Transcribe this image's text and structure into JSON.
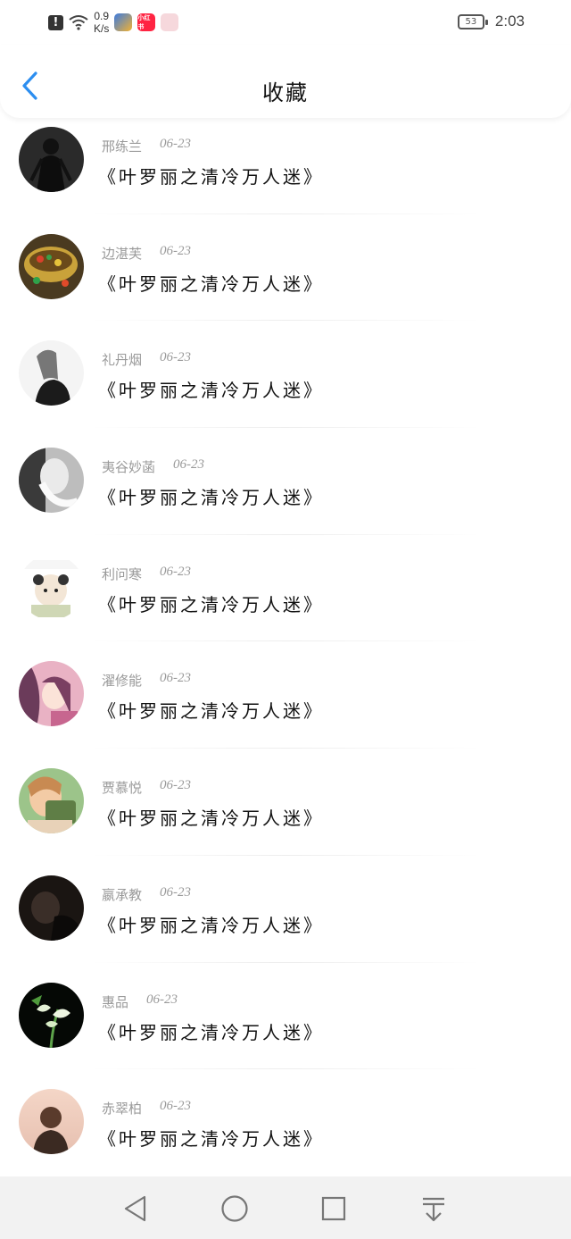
{
  "status_bar": {
    "network_speed_value": "0.9",
    "network_speed_unit": "K/s",
    "battery": "53",
    "time": "2:03",
    "app_badge_text": "小红书"
  },
  "header": {
    "title": "收藏"
  },
  "items": [
    {
      "name": "邢练兰",
      "date": "06-23",
      "title": "《叶罗丽之清冷万人迷》",
      "avatar": "dark-figure"
    },
    {
      "name": "边湛芙",
      "date": "06-23",
      "title": "《叶罗丽之清冷万人迷》",
      "avatar": "teacup"
    },
    {
      "name": "礼丹烟",
      "date": "06-23",
      "title": "《叶罗丽之清冷万人迷》",
      "avatar": "girl-bw"
    },
    {
      "name": "夷谷妙菡",
      "date": "06-23",
      "title": "《叶罗丽之清冷万人迷》",
      "avatar": "sketch"
    },
    {
      "name": "利问寒",
      "date": "06-23",
      "title": "《叶罗丽之清冷万人迷》",
      "avatar": "panda-kid"
    },
    {
      "name": "濯修能",
      "date": "06-23",
      "title": "《叶罗丽之清冷万人迷》",
      "avatar": "anime-girl"
    },
    {
      "name": "贾慕悦",
      "date": "06-23",
      "title": "《叶罗丽之清冷万人迷》",
      "avatar": "girl-book"
    },
    {
      "name": "嬴承教",
      "date": "06-23",
      "title": "《叶罗丽之清冷万人迷》",
      "avatar": "dark-portrait"
    },
    {
      "name": "惠品",
      "date": "06-23",
      "title": "《叶罗丽之清冷万人迷》",
      "avatar": "flower"
    },
    {
      "name": "赤翠柏",
      "date": "06-23",
      "title": "《叶罗丽之清冷万人迷》",
      "avatar": "sunset-boy"
    }
  ],
  "colors": {
    "accent": "#2c8ef0",
    "meta": "#9a9a9a",
    "nav_bg": "#f2f2f2"
  },
  "nav": [
    "back-triangle-icon",
    "home-circle-icon",
    "recents-square-icon",
    "notification-down-icon"
  ]
}
